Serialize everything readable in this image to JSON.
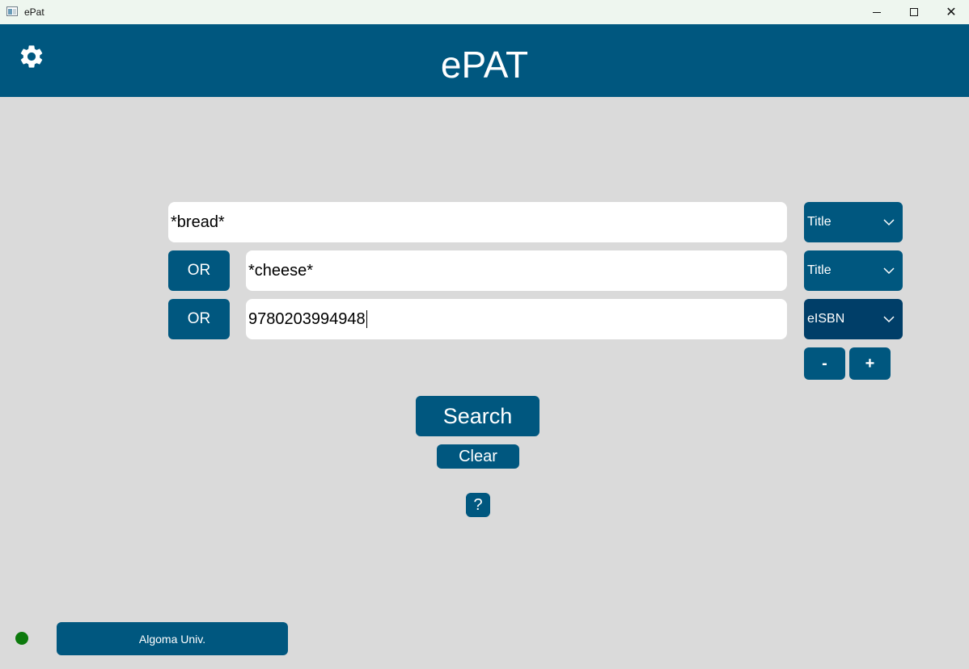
{
  "window": {
    "title": "ePat",
    "controls": {
      "minimize": "",
      "maximize": "",
      "close": "✕"
    }
  },
  "header": {
    "title": "ePAT",
    "settings_icon": "gear-icon"
  },
  "query": {
    "rows": [
      {
        "operator": null,
        "value": "*bread*",
        "field": "Title"
      },
      {
        "operator": "OR",
        "value": "*cheese*",
        "field": "Title"
      },
      {
        "operator": "OR",
        "value": "9780203994948",
        "field": "eISBN"
      }
    ],
    "remove_row_label": "-",
    "add_row_label": "+"
  },
  "actions": {
    "search_label": "Search",
    "clear_label": "Clear",
    "help_label": "?"
  },
  "footer": {
    "status_color": "#0d7a0d",
    "institution_label": "Algoma Univ."
  },
  "colors": {
    "accent": "#00577f",
    "accent_active": "#003e68",
    "background": "#dadada"
  }
}
